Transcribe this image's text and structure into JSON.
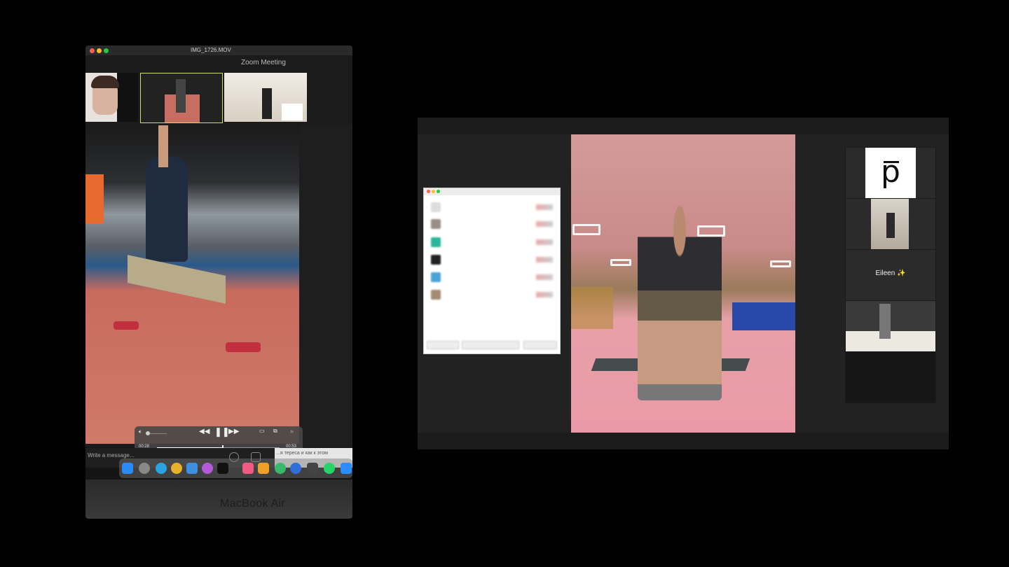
{
  "left_window": {
    "file_title": "IMG_1726.MOV",
    "zoom_title": "Zoom Meeting",
    "player": {
      "time_elapsed": "00:28",
      "time_total": "00:53",
      "progress": 0.53
    },
    "chat_placeholder": "Write a message...",
    "chat_snippet": "...я тереса и как к этом",
    "laptop_label": "MacBook Air"
  },
  "call": {
    "tiles": {
      "logo_letter": "p",
      "participant_name": "Eileen ✨"
    }
  },
  "colors": {
    "traffic_red": "#ff5f57",
    "traffic_yellow": "#febc2e",
    "traffic_green": "#28c840",
    "active_speaker_border": "#c7e36b"
  }
}
